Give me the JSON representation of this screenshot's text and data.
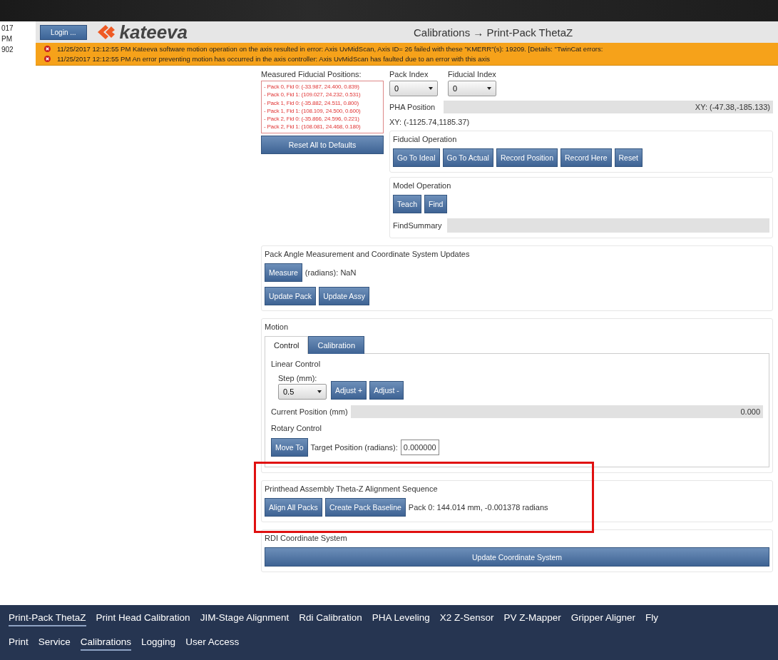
{
  "side_stub": [
    "017",
    "PM",
    "902"
  ],
  "header": {
    "login_button": "Login ...",
    "brand": "kateeva",
    "title": "Calibrations → Print-Pack ThetaZ"
  },
  "errors": [
    {
      "text": "11/25/2017 12:12:55 PM Kateeva software motion operation on the axis resulted in error: Axis UvMidScan, Axis ID= 26 failed with these \"KMERR\"(s): 19209. [Details: \"TwinCat errors:"
    },
    {
      "text": "11/25/2017 12:12:55 PM An error preventing motion has occurred in the axis controller: Axis UvMidScan has faulted due to an error with this axis"
    }
  ],
  "fiducials": {
    "label": "Measured Fiducial Positions:",
    "items": [
      "- Pack 0, Fid 0: (-33.987, 24.400, 0.839)",
      "- Pack 0, Fid 1: (109.027, 24.232, 0.531)",
      "- Pack 1, Fid 0: (-35.882, 24.511, 0.800)",
      "- Pack 1, Fid 1: (108.109, 24.500, 0.600)",
      "- Pack 2, Fid 0: (-35.866, 24.596, 0.221)",
      "- Pack 2, Fid 1: (108.081, 24.468, 0.180)"
    ],
    "reset_button": "Reset All to Defaults"
  },
  "index_selectors": [
    {
      "label": "Pack Index",
      "value": "0"
    },
    {
      "label": "Fiducial Index",
      "value": "0"
    }
  ],
  "pha_position": {
    "label": "PHA Position",
    "value": "XY: (-47.38,-185.133)",
    "xy": "XY: (-1125.74,1185.37)"
  },
  "fiducial_operation": {
    "title": "Fiducial Operation",
    "buttons": [
      "Go To Ideal",
      "Go To Actual",
      "Record Position",
      "Record Here",
      "Reset"
    ]
  },
  "model_operation": {
    "title": "Model Operation",
    "buttons": [
      "Teach",
      "Find"
    ],
    "summary_label": "FindSummary"
  },
  "pack_angle": {
    "title": "Pack Angle Measurement and Coordinate System Updates",
    "measure_button": "Measure",
    "reading": "(radians):  NaN",
    "buttons": [
      "Update Pack",
      "Update Assy"
    ]
  },
  "motion": {
    "title": "Motion",
    "tabs": [
      {
        "label": "Control",
        "selected": true
      },
      {
        "label": "Calibration",
        "selected": false
      }
    ],
    "linear": {
      "title": "Linear Control",
      "step_label": "Step (mm):",
      "step_value": "0.5",
      "buttons": [
        "Adjust +",
        "Adjust -"
      ],
      "position_label": "Current Position  (mm)",
      "position_value": "0.000"
    },
    "rotary": {
      "title": "Rotary Control",
      "button": "Move To",
      "target_label": "Target Position (radians):",
      "target_value": "0.000000"
    }
  },
  "alignment": {
    "title": "Printhead Assembly Theta-Z Alignment Sequence",
    "buttons": [
      "Align All Packs",
      "Create Pack Baseline"
    ],
    "result": "Pack 0: 144.014 mm, -0.001378 radians"
  },
  "rdi": {
    "title": "RDI Coordinate System",
    "button": "Update Coordinate System"
  },
  "nav_tabs": [
    {
      "label": "Print-Pack ThetaZ",
      "selected": true
    },
    {
      "label": "Print Head Calibration",
      "selected": false
    },
    {
      "label": "JIM-Stage Alignment",
      "selected": false
    },
    {
      "label": "Rdi Calibration",
      "selected": false
    },
    {
      "label": "PHA Leveling",
      "selected": false
    },
    {
      "label": "X2 Z-Sensor",
      "selected": false
    },
    {
      "label": "PV Z-Mapper",
      "selected": false
    },
    {
      "label": "Gripper Aligner",
      "selected": false
    },
    {
      "label": "Fly",
      "selected": false
    }
  ],
  "main_tabs": [
    {
      "label": "Print",
      "selected": false
    },
    {
      "label": "Service",
      "selected": false
    },
    {
      "label": "Calibrations",
      "selected": true
    },
    {
      "label": "Logging",
      "selected": false
    },
    {
      "label": "User Access",
      "selected": false
    }
  ]
}
